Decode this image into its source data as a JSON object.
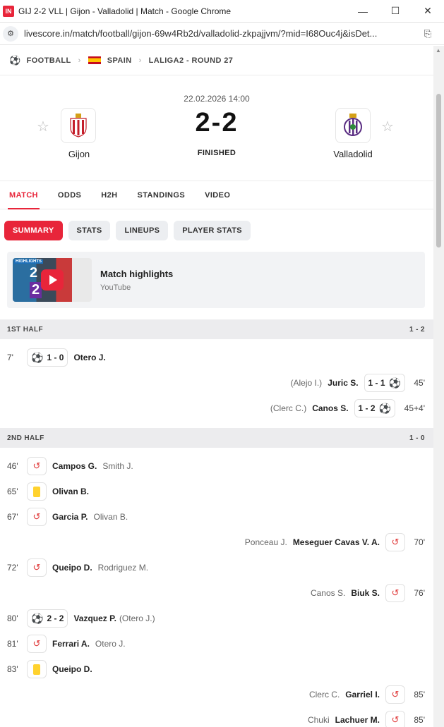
{
  "window": {
    "app_icon_text": "IN",
    "title": "GIJ 2-2 VLL | Gijon - Valladolid | Match - Google Chrome",
    "url": "livescore.in/match/football/gijon-69w4Rb2d/valladolid-zkpajjvm/?mid=I68Ouc4j&isDet..."
  },
  "breadcrumb": {
    "sport": "FOOTBALL",
    "country": "SPAIN",
    "league": "LALIGA2 - ROUND 27"
  },
  "match": {
    "datetime": "22.02.2026 14:00",
    "score": "2-2",
    "status": "FINISHED",
    "home": "Gijon",
    "away": "Valladolid"
  },
  "tabs": [
    "MATCH",
    "ODDS",
    "H2H",
    "STANDINGS",
    "VIDEO"
  ],
  "subtabs": [
    "SUMMARY",
    "STATS",
    "LINEUPS",
    "PLAYER STATS"
  ],
  "highlights": {
    "title": "Match highlights",
    "source": "YouTube",
    "thumb_label": "HIGHLIGHTS",
    "thumb_home": "2",
    "thumb_away": "2"
  },
  "first_half": {
    "label": "1ST HALF",
    "score": "1 - 2",
    "events": [
      {
        "minute": "7'",
        "score": "1 - 0",
        "player": "Otero J."
      },
      {
        "minute": "45'",
        "score": "1 - 1",
        "player": "Juric S.",
        "assist": "(Alejo I.)"
      },
      {
        "minute": "45+4'",
        "score": "1 - 2",
        "player": "Canos S.",
        "assist": "(Clerc C.)"
      }
    ]
  },
  "second_half": {
    "label": "2ND HALF",
    "score": "1 - 0",
    "events": [
      {
        "minute": "46'",
        "player": "Campos G.",
        "secondary": "Smith J."
      },
      {
        "minute": "65'",
        "player": "Olivan B."
      },
      {
        "minute": "67'",
        "player": "Garcia P.",
        "secondary": "Olivan B."
      },
      {
        "minute": "70'",
        "player": "Meseguer Cavas V. A.",
        "secondary": "Ponceau J."
      },
      {
        "minute": "72'",
        "player": "Queipo D.",
        "secondary": "Rodriguez M."
      },
      {
        "minute": "76'",
        "player": "Biuk S.",
        "secondary": "Canos S."
      },
      {
        "minute": "80'",
        "score": "2 - 2",
        "player": "Vazquez P.",
        "secondary": "(Otero J.)"
      },
      {
        "minute": "81'",
        "player": "Ferrari A.",
        "secondary": "Otero J."
      },
      {
        "minute": "83'",
        "player": "Queipo D."
      },
      {
        "minute": "85'",
        "player": "Garriel I.",
        "secondary": "Clerc C."
      },
      {
        "minute": "85'",
        "player": "Lachuer M.",
        "secondary": "Chuki"
      }
    ]
  },
  "colors": {
    "accent": "#e8253a",
    "yellow_card": "#ffd22e"
  }
}
